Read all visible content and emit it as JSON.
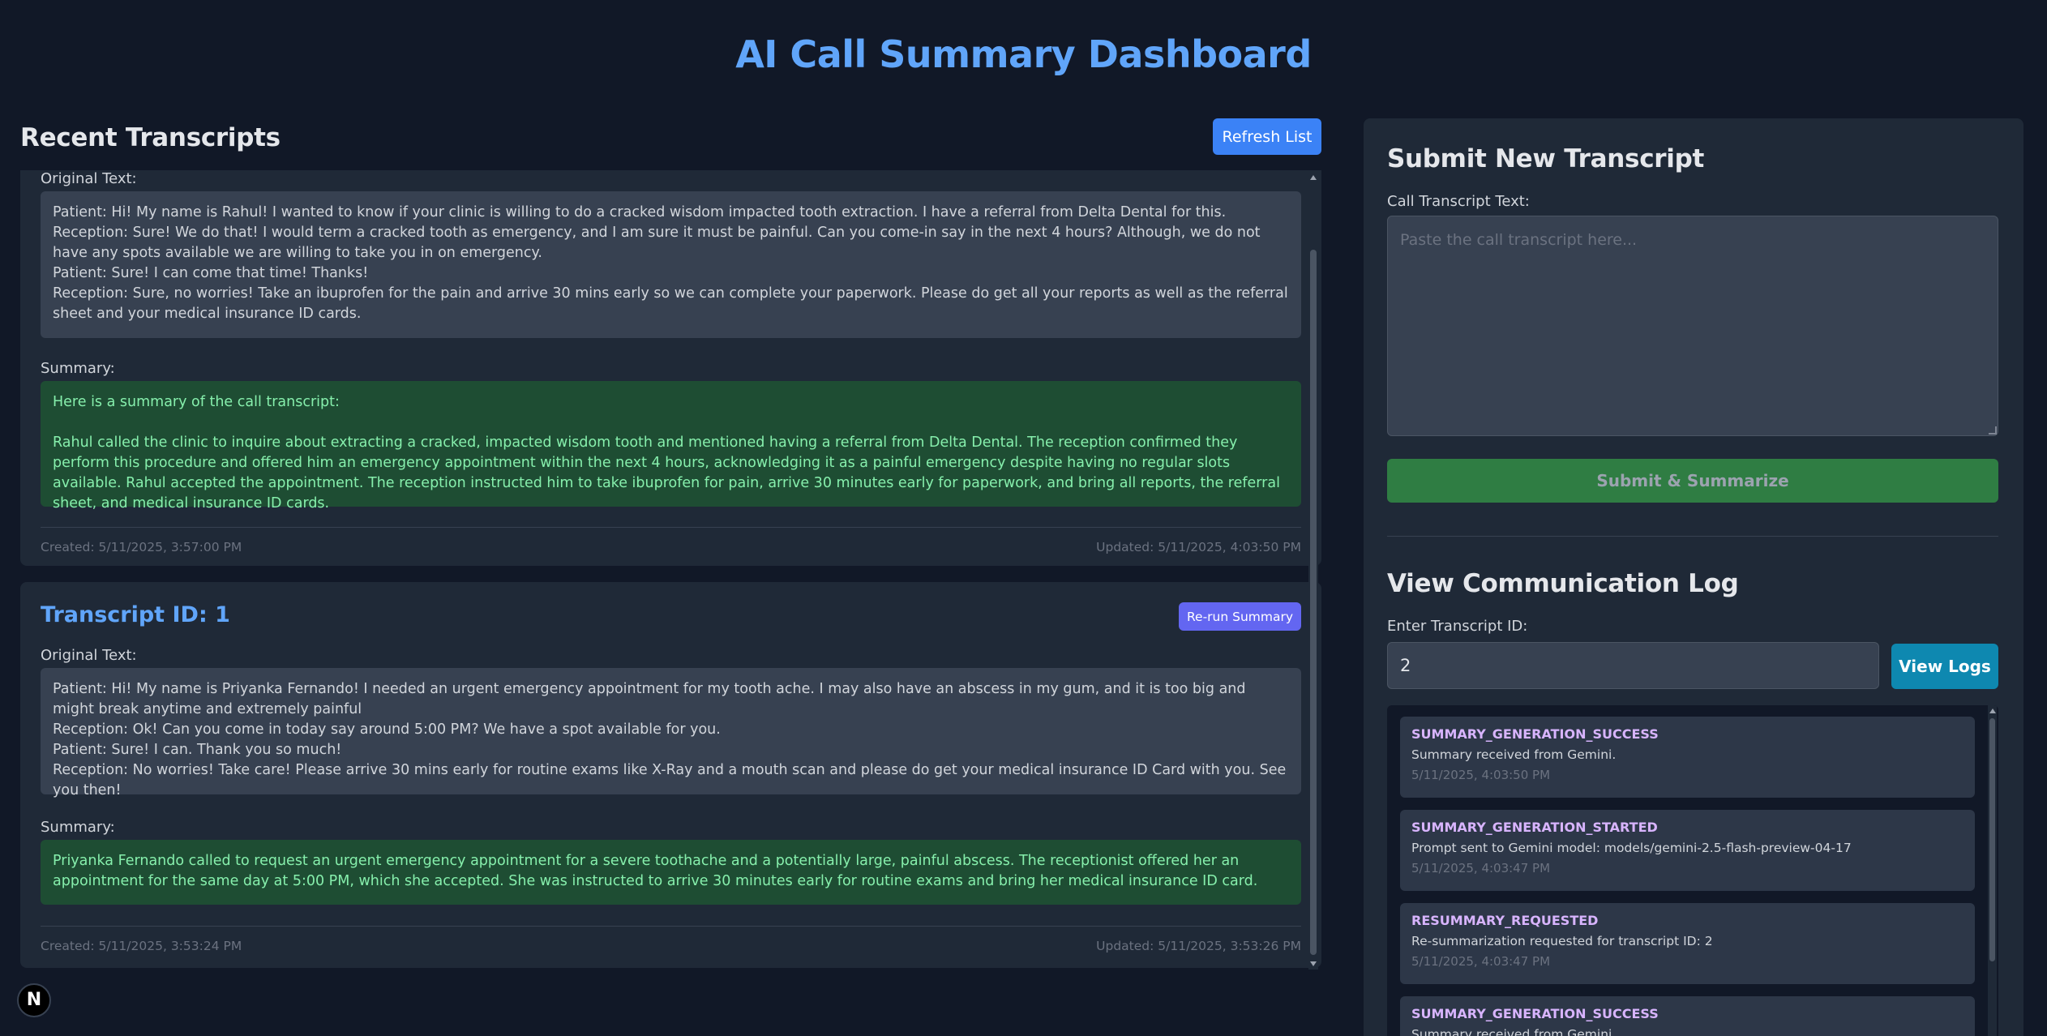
{
  "page": {
    "title": "AI Call Summary Dashboard"
  },
  "transcripts_section": {
    "title": "Recent Transcripts",
    "refresh_label": "Refresh List",
    "cards": [
      {
        "original_label": "Original Text:",
        "original_lines": [
          "Patient: Hi! My name is Rahul! I wanted to know if your clinic is willing to do a cracked wisdom impacted tooth extraction. I have a referral from Delta Dental for this.",
          "Reception: Sure! We do that! I would term a cracked tooth as emergency, and I am sure it must be painful. Can you come-in say in the next 4 hours? Although, we do not have any spots available we are willing to take you in on emergency.",
          "Patient: Sure! I can come that time! Thanks!",
          "Reception: Sure, no worries! Take an ibuprofen for the pain and arrive 30 mins early so we can complete your paperwork. Please do get all your reports as well as the referral sheet and your medical insurance ID cards."
        ],
        "summary_label": "Summary:",
        "summary_intro": "Here is a summary of the call transcript:",
        "summary_text": "Rahul called the clinic to inquire about extracting a cracked, impacted wisdom tooth and mentioned having a referral from Delta Dental. The reception confirmed they perform this procedure and offered him an emergency appointment within the next 4 hours, acknowledging it as a painful emergency despite having no regular slots available. Rahul accepted the appointment. The reception instructed him to take ibuprofen for pain, arrive 30 minutes early for paperwork, and bring all reports, the referral sheet, and medical insurance ID cards.",
        "created": "Created: 5/11/2025, 3:57:00 PM",
        "updated": "Updated: 5/11/2025, 4:03:50 PM"
      },
      {
        "title": "Transcript ID: 1",
        "rerun_label": "Re-run Summary",
        "original_label": "Original Text:",
        "original_lines": [
          "Patient: Hi! My name is Priyanka Fernando! I needed an urgent emergency appointment for my tooth ache. I may also have an abscess in my gum, and it is too big and might break anytime and extremely painful",
          "Reception:  Ok! Can you come in today say around 5:00 PM? We have a spot available for you.",
          "Patient: Sure! I can. Thank you so much!",
          "Reception: No worries! Take care! Please arrive 30 mins early for routine exams like X-Ray and a mouth scan and please do get your medical insurance ID Card with you. See you then!"
        ],
        "summary_label": "Summary:",
        "summary_text": "Priyanka Fernando called to request an urgent emergency appointment for a severe toothache and a potentially large, painful abscess. The receptionist offered her an appointment for the same day at 5:00 PM, which she accepted. She was instructed to arrive 30 minutes early for routine exams and bring her medical insurance ID card.",
        "created": "Created: 5/11/2025, 3:53:24 PM",
        "updated": "Updated: 5/11/2025, 3:53:26 PM"
      }
    ]
  },
  "submit_section": {
    "title": "Submit New Transcript",
    "field_label": "Call Transcript Text:",
    "placeholder": "Paste the call transcript here...",
    "submit_label": "Submit & Summarize"
  },
  "log_section": {
    "title": "View Communication Log",
    "field_label": "Enter Transcript ID:",
    "id_value": "2",
    "view_label": "View Logs",
    "entries": [
      {
        "type": "SUMMARY_GENERATION_SUCCESS",
        "message": "Summary received from Gemini.",
        "time": "5/11/2025, 4:03:50 PM"
      },
      {
        "type": "SUMMARY_GENERATION_STARTED",
        "message": "Prompt sent to Gemini model: models/gemini-2.5-flash-preview-04-17",
        "time": "5/11/2025, 4:03:47 PM"
      },
      {
        "type": "RESUMMARY_REQUESTED",
        "message": "Re-summarization requested for transcript ID: 2",
        "time": "5/11/2025, 4:03:47 PM"
      },
      {
        "type": "SUMMARY_GENERATION_SUCCESS",
        "message": "Summary received from Gemini.",
        "time": ""
      }
    ]
  },
  "badge": {
    "letter": "N"
  },
  "icons": {
    "badge_icon": "nextjs-logo-icon"
  }
}
